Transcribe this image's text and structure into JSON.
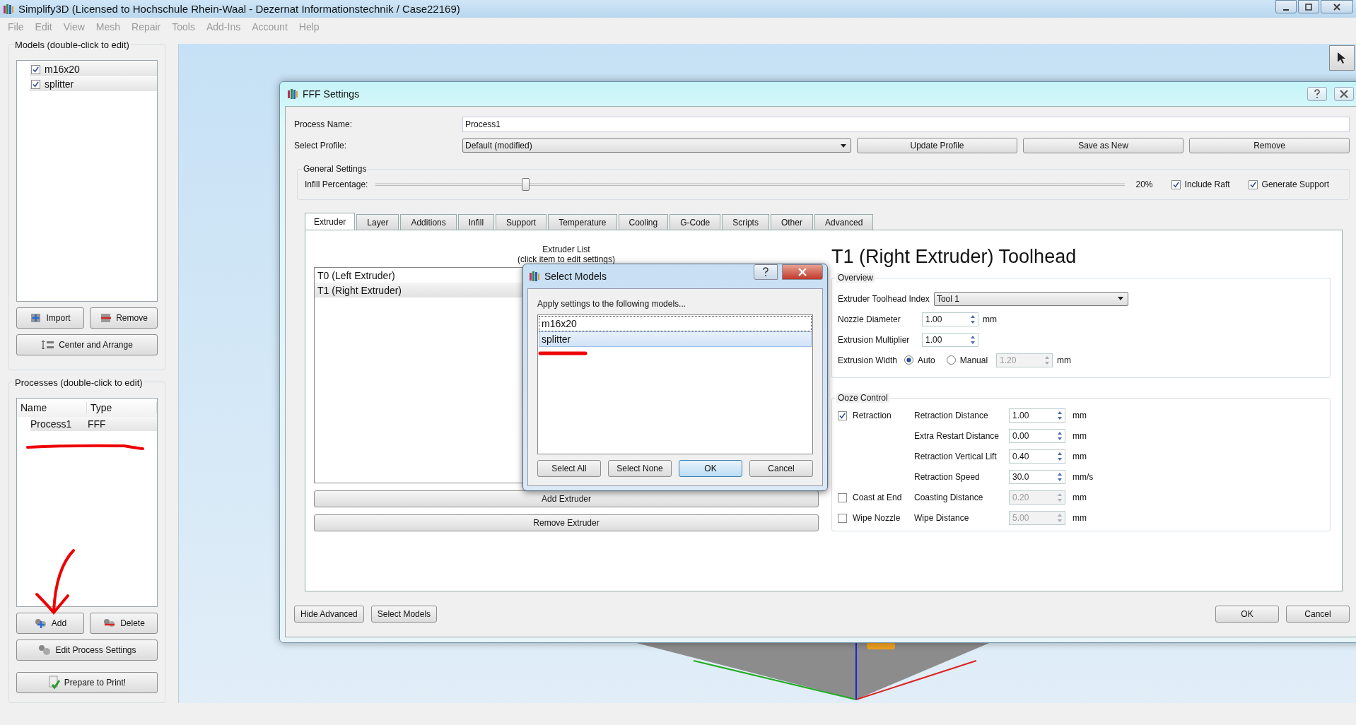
{
  "window": {
    "title": "Simplify3D (Licensed to Hochschule Rhein-Waal - Dezernat Informationstechnik / Case22169)"
  },
  "menu": [
    {
      "label": "File",
      "disabled": true
    },
    {
      "label": "Edit",
      "disabled": true
    },
    {
      "label": "View",
      "disabled": true
    },
    {
      "label": "Mesh",
      "disabled": true
    },
    {
      "label": "Repair",
      "disabled": true
    },
    {
      "label": "Tools",
      "disabled": true
    },
    {
      "label": "Add-Ins",
      "disabled": true
    },
    {
      "label": "Account",
      "disabled": true
    },
    {
      "label": "Help",
      "disabled": true
    }
  ],
  "models_panel": {
    "title": "Models (double-click to edit)",
    "models": [
      {
        "name": "m16x20",
        "checked": true
      },
      {
        "name": "splitter",
        "checked": true
      }
    ],
    "import_button": "Import",
    "remove_button": "Remove",
    "arrange_button": "Center and Arrange"
  },
  "processes_panel": {
    "title": "Processes (double-click to edit)",
    "columns": [
      "Name",
      "Type"
    ],
    "rows": [
      {
        "name": "Process1",
        "type": "FFF"
      }
    ],
    "add_button": "Add",
    "delete_button": "Delete",
    "edit_button": "Edit Process Settings",
    "prepare_button": "Prepare to Print!"
  },
  "settings_window": {
    "title": "FFF Settings",
    "process_name_label": "Process Name:",
    "process_name": "Process1",
    "profile_label": "Select Profile:",
    "profile": "Default (modified)",
    "profile_buttons": [
      "Update Profile",
      "Save as New",
      "Remove"
    ],
    "general_title": "General Settings",
    "infill_label": "Infill Percentage:",
    "infill": {
      "level": 0.2
    },
    "infill_reading": "20%",
    "include_raft": {
      "label": "Include Raft",
      "checked": true
    },
    "generate_support": {
      "label": "Generate Support",
      "checked": true
    },
    "tabs": [
      {
        "label": "Extruder",
        "selected": true
      },
      {
        "label": "Layer",
        "selected": false
      },
      {
        "label": "Additions",
        "selected": false
      },
      {
        "label": "Infill",
        "selected": false
      },
      {
        "label": "Support",
        "selected": false
      },
      {
        "label": "Temperature",
        "selected": false
      },
      {
        "label": "Cooling",
        "selected": false
      },
      {
        "label": "G-Code",
        "selected": false
      },
      {
        "label": "Scripts",
        "selected": false
      },
      {
        "label": "Other",
        "selected": false
      },
      {
        "label": "Advanced",
        "selected": false
      }
    ],
    "extruder_list_title": "Extruder List",
    "extruder_list_hint": "(click item to edit settings)",
    "extruders": [
      {
        "name": "T0 (Left Extruder)",
        "selected": false
      },
      {
        "name": "T1 (Right Extruder)",
        "selected": true
      }
    ],
    "add_extruder_button": "Add Extruder",
    "remove_extruder_button": "Remove Extruder",
    "toolhead_title": "T1 (Right Extruder) Toolhead",
    "overview": {
      "title": "Overview",
      "toolhead_index": {
        "label": "Extruder Toolhead Index",
        "value": "Tool 1"
      },
      "fields": [
        {
          "label": "Nozzle Diameter",
          "value": "1.00",
          "unit": "mm"
        },
        {
          "label": "Extrusion Multiplier",
          "value": "1.00"
        }
      ],
      "width": {
        "label": "Extrusion Width",
        "options": [
          {
            "label": "Auto",
            "selected": true
          },
          {
            "label": "Manual",
            "selected": false
          }
        ],
        "value": "1.20",
        "disabled": true,
        "unit": "mm"
      }
    },
    "ooze_control": {
      "title": "Ooze Control",
      "groups": [
        {
          "label": "Retraction",
          "checked": true,
          "fields": [
            {
              "label": "Retraction Distance",
              "value": "1.00",
              "unit": "mm",
              "disabled": false
            },
            {
              "label": "Extra Restart Distance",
              "value": "0.00",
              "unit": "mm",
              "disabled": false
            },
            {
              "label": "Retraction Vertical Lift",
              "value": "0.40",
              "unit": "mm",
              "disabled": false
            },
            {
              "label": "Retraction Speed",
              "value": "30.0",
              "unit": "mm/s",
              "disabled": false
            }
          ]
        },
        {
          "label": "Coast at End",
          "checked": false,
          "fields": [
            {
              "label": "Coasting Distance",
              "value": "0.20",
              "unit": "mm",
              "disabled": true
            }
          ]
        },
        {
          "label": "Wipe Nozzle",
          "checked": false,
          "fields": [
            {
              "label": "Wipe Distance",
              "value": "5.00",
              "unit": "mm",
              "disabled": true
            }
          ]
        }
      ]
    },
    "hide_advanced_button": "Hide Advanced",
    "select_models_button": "Select Models",
    "ok_button": "OK",
    "cancel_button": "Cancel"
  },
  "select_models_dialog": {
    "title": "Select Models",
    "prompt": "Apply settings to the following models...",
    "models": [
      {
        "name": "m16x20",
        "selected": false,
        "focused": true
      },
      {
        "name": "splitter",
        "selected": true,
        "focused": false
      }
    ],
    "buttons": [
      {
        "label": "Select All",
        "default": false
      },
      {
        "label": "Select None",
        "default": false
      },
      {
        "label": "OK",
        "default": true
      },
      {
        "label": "Cancel",
        "default": false
      }
    ]
  }
}
